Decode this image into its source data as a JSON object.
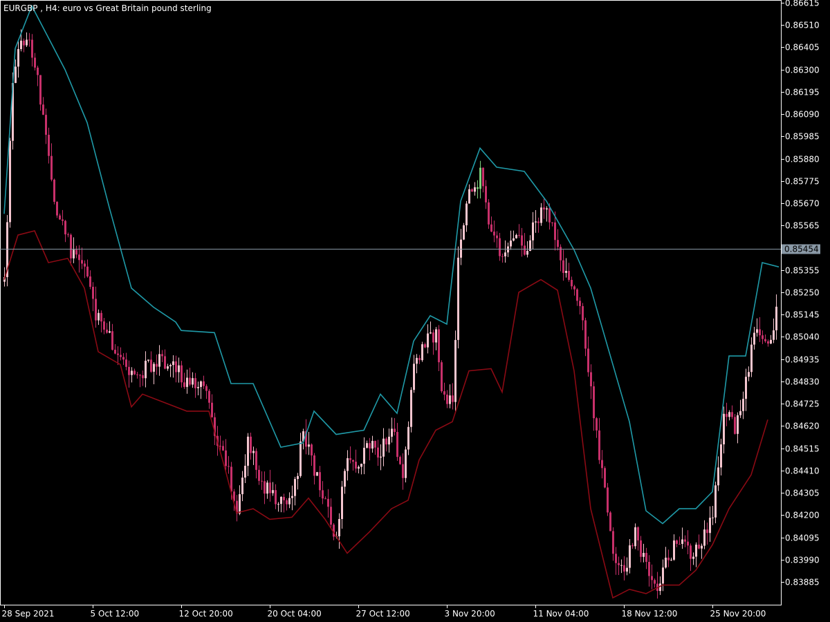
{
  "chart_data": {
    "type": "candlestick",
    "symbol": "EURGBP",
    "timeframe": "H4",
    "title": "EURGBP , H4:  euro vs Great Britain pound sterling",
    "ylim": [
      0.8381,
      0.86615
    ],
    "y_ticks": [
      "0.86615",
      "0.86510",
      "0.86405",
      "0.86300",
      "0.86195",
      "0.86090",
      "0.85985",
      "0.85880",
      "0.85775",
      "0.85670",
      "0.85565",
      "0.85355",
      "0.85250",
      "0.85145",
      "0.85040",
      "0.84935",
      "0.84830",
      "0.84725",
      "0.84620",
      "0.84515",
      "0.84410",
      "0.84305",
      "0.84200",
      "0.84095",
      "0.83990",
      "0.83885"
    ],
    "x_tick_labels": [
      "28 Sep 2021",
      "5 Oct 12:00",
      "12 Oct 20:00",
      "20 Oct 04:00",
      "27 Oct 12:00",
      "3 Nov 20:00",
      "11 Nov 04:00",
      "18 Nov 12:00",
      "25 Nov 20:00"
    ],
    "x_tick_bar_index": [
      0,
      32,
      64,
      96,
      128,
      160,
      192,
      224,
      256
    ],
    "bar_count": 280,
    "current_price": "0.85454",
    "colors": {
      "background": "#000000",
      "axis": "#ffffff",
      "bull": "#f5c6cf",
      "bear": "#c8306a",
      "doji": "#7cd17c",
      "upper_band": "#1f9aa8",
      "lower_band": "#8b0a14",
      "price_line": "#8a99a6",
      "price_label_bg": "#8a99a6"
    },
    "upper_band": [
      [
        0,
        0.8562
      ],
      [
        4,
        0.864
      ],
      [
        10,
        0.866
      ],
      [
        16,
        0.8645
      ],
      [
        22,
        0.863
      ],
      [
        30,
        0.8605
      ],
      [
        38,
        0.8565
      ],
      [
        46,
        0.8527
      ],
      [
        54,
        0.8518
      ],
      [
        62,
        0.8511
      ],
      [
        64,
        0.8507
      ],
      [
        76,
        0.8506
      ],
      [
        82,
        0.8482
      ],
      [
        90,
        0.8482
      ],
      [
        100,
        0.8452
      ],
      [
        108,
        0.8454
      ],
      [
        112,
        0.8469
      ],
      [
        120,
        0.8458
      ],
      [
        130,
        0.846
      ],
      [
        136,
        0.8477
      ],
      [
        142,
        0.8468
      ],
      [
        148,
        0.8502
      ],
      [
        154,
        0.8514
      ],
      [
        160,
        0.851
      ],
      [
        165,
        0.8568
      ],
      [
        172,
        0.8593
      ],
      [
        178,
        0.8584
      ],
      [
        188,
        0.8582
      ],
      [
        196,
        0.8568
      ],
      [
        206,
        0.8545
      ],
      [
        212,
        0.8527
      ],
      [
        226,
        0.8464
      ],
      [
        232,
        0.8422
      ],
      [
        238,
        0.8416
      ],
      [
        244,
        0.8423
      ],
      [
        250,
        0.8423
      ],
      [
        256,
        0.8431
      ],
      [
        262,
        0.8495
      ],
      [
        268,
        0.8495
      ],
      [
        274,
        0.8539
      ],
      [
        280,
        0.8537
      ]
    ],
    "lower_band": [
      [
        0,
        0.8531
      ],
      [
        5,
        0.8552
      ],
      [
        11,
        0.8554
      ],
      [
        16,
        0.8539
      ],
      [
        23,
        0.8541
      ],
      [
        29,
        0.8527
      ],
      [
        34,
        0.8497
      ],
      [
        42,
        0.8491
      ],
      [
        46,
        0.8471
      ],
      [
        50,
        0.8477
      ],
      [
        56,
        0.8474
      ],
      [
        66,
        0.8469
      ],
      [
        74,
        0.8469
      ],
      [
        80,
        0.8441
      ],
      [
        84,
        0.8421
      ],
      [
        90,
        0.8423
      ],
      [
        96,
        0.8418
      ],
      [
        104,
        0.8419
      ],
      [
        110,
        0.8428
      ],
      [
        116,
        0.8418
      ],
      [
        124,
        0.8402
      ],
      [
        132,
        0.8412
      ],
      [
        140,
        0.8423
      ],
      [
        146,
        0.8427
      ],
      [
        150,
        0.8446
      ],
      [
        156,
        0.846
      ],
      [
        162,
        0.8464
      ],
      [
        168,
        0.8488
      ],
      [
        176,
        0.8489
      ],
      [
        180,
        0.8478
      ],
      [
        186,
        0.8525
      ],
      [
        194,
        0.8531
      ],
      [
        200,
        0.8526
      ],
      [
        206,
        0.8488
      ],
      [
        212,
        0.8423
      ],
      [
        220,
        0.8381
      ],
      [
        226,
        0.8385
      ],
      [
        232,
        0.8383
      ],
      [
        238,
        0.8387
      ],
      [
        244,
        0.8387
      ],
      [
        250,
        0.8394
      ],
      [
        256,
        0.8406
      ],
      [
        262,
        0.8423
      ],
      [
        270,
        0.8439
      ],
      [
        276,
        0.8465
      ]
    ],
    "close_anchors": [
      [
        0,
        0.853
      ],
      [
        3,
        0.8625
      ],
      [
        6,
        0.8645
      ],
      [
        9,
        0.864
      ],
      [
        12,
        0.8625
      ],
      [
        15,
        0.8595
      ],
      [
        18,
        0.857
      ],
      [
        21,
        0.8555
      ],
      [
        24,
        0.8545
      ],
      [
        27,
        0.854
      ],
      [
        30,
        0.853
      ],
      [
        33,
        0.8515
      ],
      [
        36,
        0.8505
      ],
      [
        40,
        0.85
      ],
      [
        44,
        0.849
      ],
      [
        48,
        0.8484
      ],
      [
        52,
        0.849
      ],
      [
        56,
        0.8495
      ],
      [
        60,
        0.849
      ],
      [
        64,
        0.8485
      ],
      [
        68,
        0.8482
      ],
      [
        72,
        0.848
      ],
      [
        76,
        0.846
      ],
      [
        80,
        0.8445
      ],
      [
        84,
        0.8425
      ],
      [
        88,
        0.8455
      ],
      [
        92,
        0.844
      ],
      [
        96,
        0.8428
      ],
      [
        100,
        0.843
      ],
      [
        104,
        0.8425
      ],
      [
        108,
        0.846
      ],
      [
        112,
        0.844
      ],
      [
        116,
        0.8425
      ],
      [
        120,
        0.841
      ],
      [
        124,
        0.845
      ],
      [
        128,
        0.8445
      ],
      [
        132,
        0.8455
      ],
      [
        136,
        0.845
      ],
      [
        140,
        0.8462
      ],
      [
        144,
        0.844
      ],
      [
        148,
        0.849
      ],
      [
        152,
        0.8502
      ],
      [
        156,
        0.8505
      ],
      [
        158,
        0.848
      ],
      [
        162,
        0.847
      ],
      [
        164,
        0.854
      ],
      [
        168,
        0.857
      ],
      [
        172,
        0.858
      ],
      [
        176,
        0.8555
      ],
      [
        180,
        0.854
      ],
      [
        184,
        0.855
      ],
      [
        188,
        0.8545
      ],
      [
        192,
        0.856
      ],
      [
        196,
        0.8565
      ],
      [
        200,
        0.8545
      ],
      [
        204,
        0.8528
      ],
      [
        208,
        0.852
      ],
      [
        212,
        0.848
      ],
      [
        216,
        0.844
      ],
      [
        220,
        0.84
      ],
      [
        224,
        0.8395
      ],
      [
        228,
        0.841
      ],
      [
        232,
        0.8395
      ],
      [
        236,
        0.8388
      ],
      [
        240,
        0.84
      ],
      [
        244,
        0.841
      ],
      [
        248,
        0.8402
      ],
      [
        252,
        0.8407
      ],
      [
        256,
        0.842
      ],
      [
        260,
        0.847
      ],
      [
        264,
        0.8462
      ],
      [
        268,
        0.8485
      ],
      [
        272,
        0.851
      ],
      [
        276,
        0.85
      ],
      [
        279,
        0.8515
      ]
    ]
  }
}
